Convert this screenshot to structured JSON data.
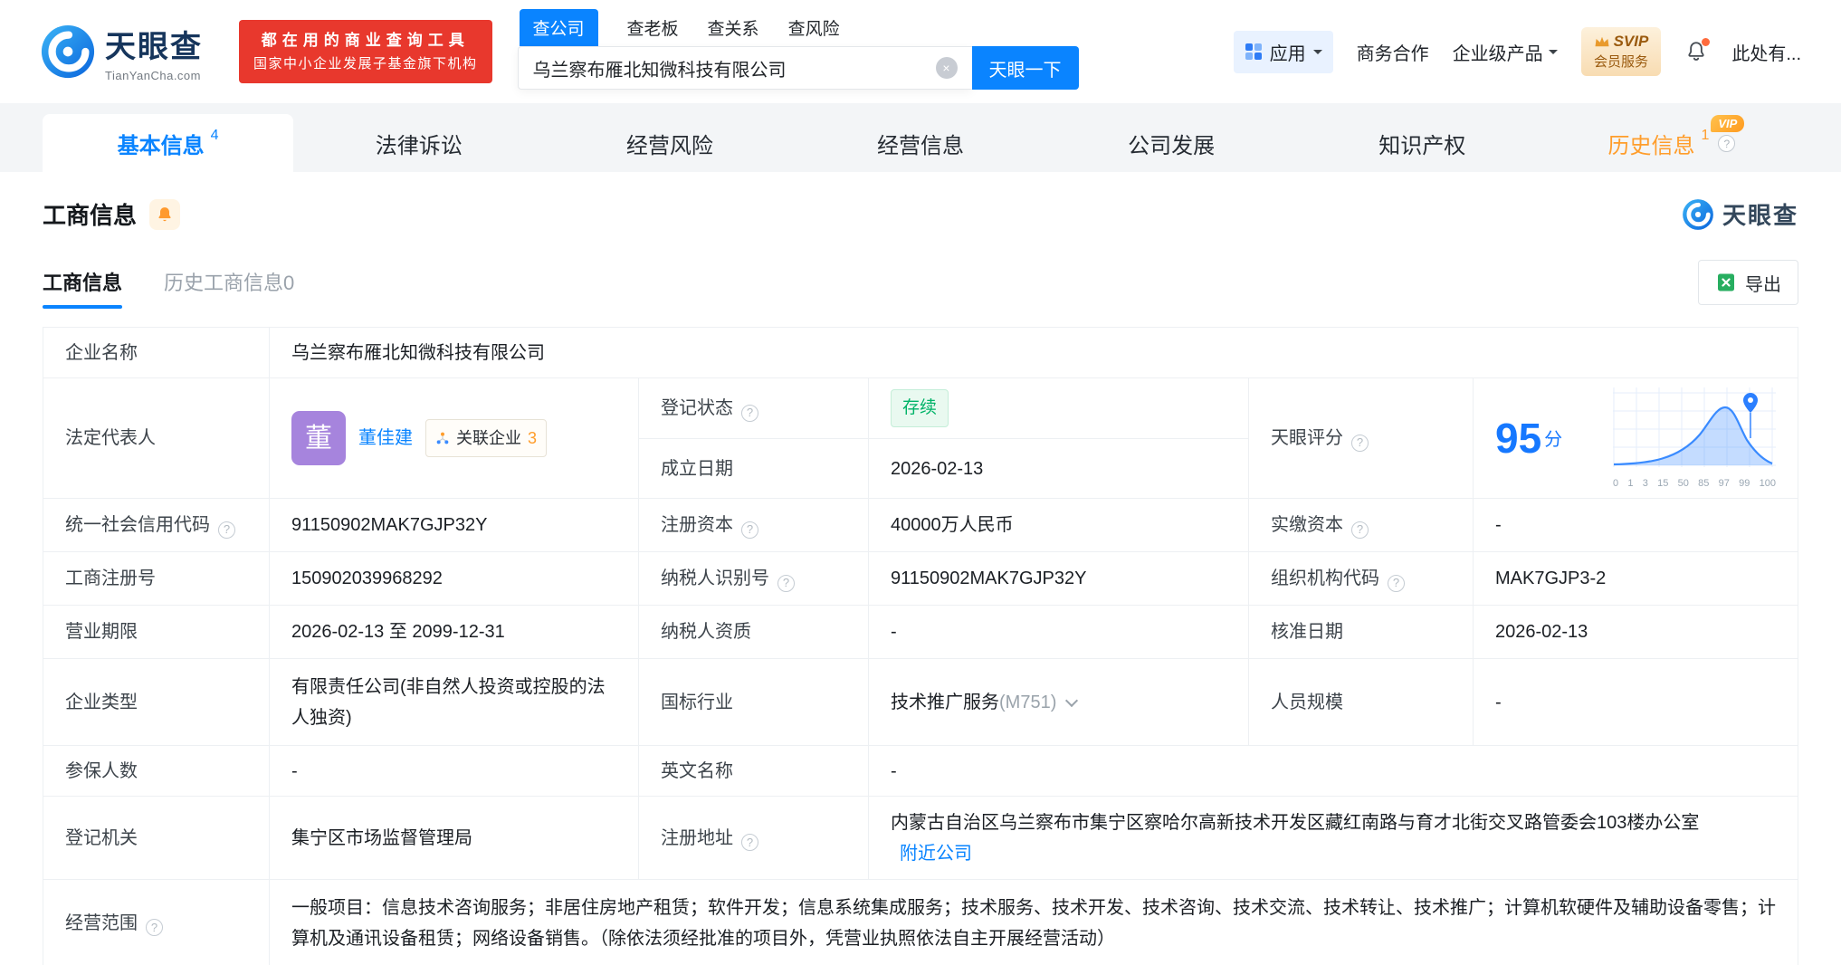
{
  "colors": {
    "brand_blue": "#0a84ff",
    "status_green": "#00b368",
    "vip_orange": "#ff9d2b",
    "promo_red": "#e8382d",
    "score_blue": "#1678ff"
  },
  "icons": {
    "help": "?",
    "clear": "×"
  },
  "brand": {
    "name": "天眼查",
    "domain": "TianYanCha.com"
  },
  "promo": {
    "line1": "都在用的商业查询工具",
    "line2": "国家中小企业发展子基金旗下机构"
  },
  "search": {
    "tabs": [
      {
        "label": "查公司"
      },
      {
        "label": "查老板"
      },
      {
        "label": "查关系"
      },
      {
        "label": "查风险"
      }
    ],
    "value": "乌兰察布雁北知微科技有限公司",
    "button": "天眼一下"
  },
  "topmenu": {
    "apps": "应用",
    "cooperation": "商务合作",
    "enterprise": "企业级产品",
    "svip_top": "SVIP",
    "svip_bottom": "会员服务",
    "more": "此处有..."
  },
  "nav": {
    "tabs": [
      {
        "label": "基本信息",
        "count": "4"
      },
      {
        "label": "法律诉讼"
      },
      {
        "label": "经营风险"
      },
      {
        "label": "经营信息"
      },
      {
        "label": "公司发展"
      },
      {
        "label": "知识产权"
      },
      {
        "label": "历史信息",
        "count": "1",
        "vip": "VIP"
      }
    ]
  },
  "section": {
    "title": "工商信息",
    "logo_text": "天眼查"
  },
  "subtabs": {
    "current": "工商信息",
    "history": "历史工商信息0",
    "export": "导出"
  },
  "info": {
    "company_name_label": "企业名称",
    "company_name": "乌兰察布雁北知微科技有限公司",
    "legal_rep_label": "法定代表人",
    "legal_rep_avatar": "董",
    "legal_rep_name": "董佳建",
    "related_label": "关联企业",
    "related_count": "3",
    "reg_status_label": "登记状态",
    "reg_status": "存续",
    "est_date_label": "成立日期",
    "est_date": "2026-02-13",
    "score_label": "天眼评分",
    "score_value": "95",
    "score_unit": "分",
    "score_axis": [
      "0",
      "1",
      "3",
      "15",
      "50",
      "85",
      "97",
      "99",
      "100"
    ],
    "credit_code_label": "统一社会信用代码",
    "credit_code": "91150902MAK7GJP32Y",
    "reg_capital_label": "注册资本",
    "reg_capital": "40000万人民币",
    "paid_capital_label": "实缴资本",
    "paid_capital": "-",
    "reg_number_label": "工商注册号",
    "reg_number": "150902039968292",
    "taxpayer_id_label": "纳税人识别号",
    "taxpayer_id": "91150902MAK7GJP32Y",
    "org_code_label": "组织机构代码",
    "org_code": "MAK7GJP3-2",
    "business_term_label": "营业期限",
    "business_term": "2026-02-13 至 2099-12-31",
    "taxpayer_quality_label": "纳税人资质",
    "taxpayer_quality": "-",
    "approval_date_label": "核准日期",
    "approval_date": "2026-02-13",
    "company_type_label": "企业类型",
    "company_type": "有限责任公司(非自然人投资或控股的法人独资)",
    "industry_label": "国标行业",
    "industry": "技术推广服务",
    "industry_code": "(M751)",
    "staff_size_label": "人员规模",
    "staff_size": "-",
    "insured_label": "参保人数",
    "insured": "-",
    "english_name_label": "英文名称",
    "english_name": "-",
    "reg_authority_label": "登记机关",
    "reg_authority": "集宁区市场监督管理局",
    "address_label": "注册地址",
    "address": "内蒙古自治区乌兰察布市集宁区察哈尔高新技术开发区藏红南路与育才北街交叉路管委会103楼办公室",
    "nearby_link": "附近公司",
    "scope_label": "经营范围",
    "scope": "一般项目：信息技术咨询服务；非居住房地产租赁；软件开发；信息系统集成服务；技术服务、技术开发、技术咨询、技术交流、技术转让、技术推广；计算机软硬件及辅助设备零售；计算机及通讯设备租赁；网络设备销售。（除依法须经批准的项目外，凭营业执照依法自主开展经营活动）"
  }
}
